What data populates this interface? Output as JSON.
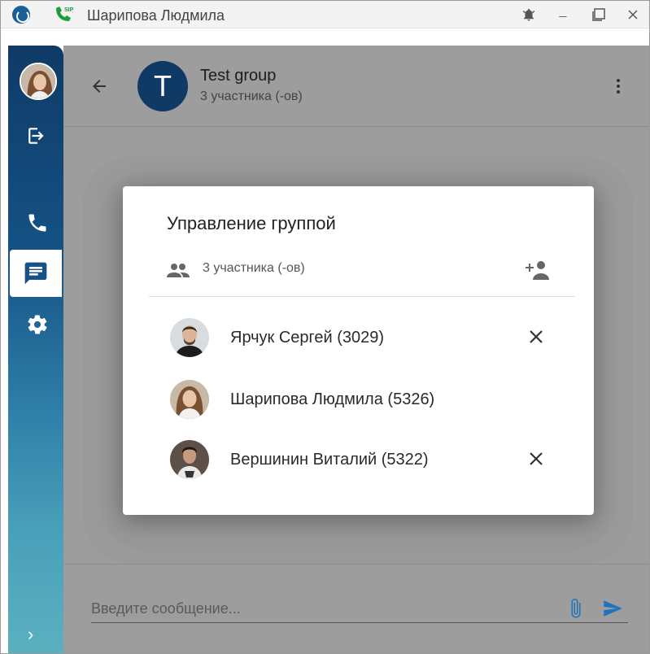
{
  "window": {
    "title": "Шарипова Людмила",
    "minimize_label": "_",
    "sip_badge": "SIP"
  },
  "sidebar": {
    "expand_label": "›"
  },
  "chat": {
    "group_initial": "T",
    "group_name": "Test group",
    "member_count": "3 участника (-ов)"
  },
  "composer": {
    "placeholder": "Введите сообщение..."
  },
  "dialog": {
    "title": "Управление группой",
    "member_count": "3 участника (-ов)",
    "members": [
      {
        "name": "Ярчук Сергей (3029)",
        "removable": true
      },
      {
        "name": "Шарипова Людмила (5326)",
        "removable": false
      },
      {
        "name": "Вершинин Виталий (5322)",
        "removable": true
      }
    ]
  },
  "colors": {
    "brand": "#0f3a66",
    "accent": "#1e73be",
    "overlay": "#9d9d9d"
  },
  "icons": [
    "app-logo-icon",
    "sip-phone-icon",
    "bell-icon",
    "minimize-icon",
    "maximize-icon",
    "close-icon",
    "logout-icon",
    "phone-icon",
    "chat-icon",
    "gear-icon",
    "chevron-right-icon",
    "back-arrow-icon",
    "more-vert-icon",
    "group-icon",
    "add-person-icon",
    "paperclip-icon",
    "send-icon"
  ]
}
